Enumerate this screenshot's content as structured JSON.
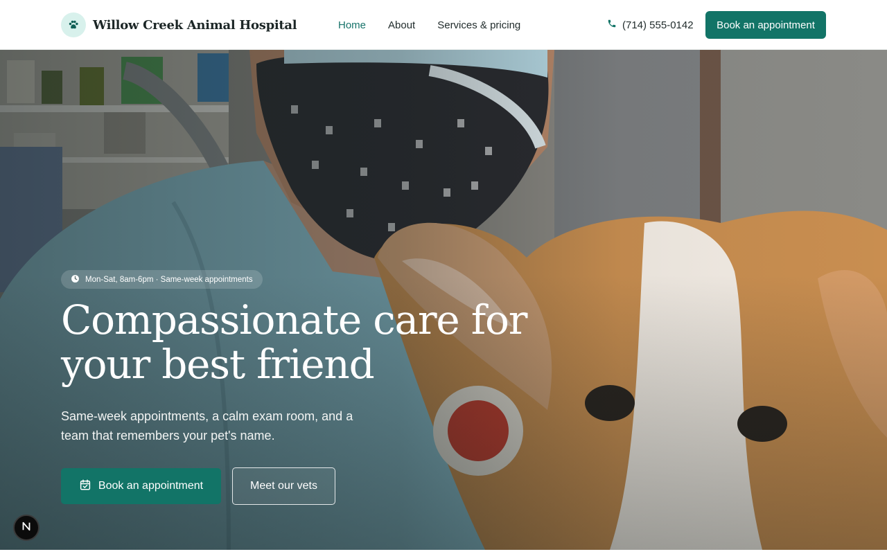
{
  "header": {
    "brand_name": "Willow Creek Animal Hospital",
    "brand_icon": "paw-icon",
    "nav": [
      {
        "label": "Home",
        "active": true
      },
      {
        "label": "About",
        "active": false
      },
      {
        "label": "Services & pricing",
        "active": false
      }
    ],
    "phone": "(714) 555-0142",
    "cta_label": "Book an appointment"
  },
  "hero": {
    "hours_badge": "Mon-Sat, 8am-6pm · Same-week appointments",
    "title": "Compassionate care for your best friend",
    "subtitle": "Same-week appointments, a calm exam room, and a team that remembers your pet's name.",
    "primary_cta": "Book an appointment",
    "secondary_cta": "Meet our vets",
    "scene_description_icon": "vet-with-dog-photo"
  },
  "dev_badge": {
    "letter": "N"
  },
  "colors": {
    "brand_green": "#127467",
    "nav_active": "#17736a",
    "badge_mint": "#d8f1ec"
  }
}
